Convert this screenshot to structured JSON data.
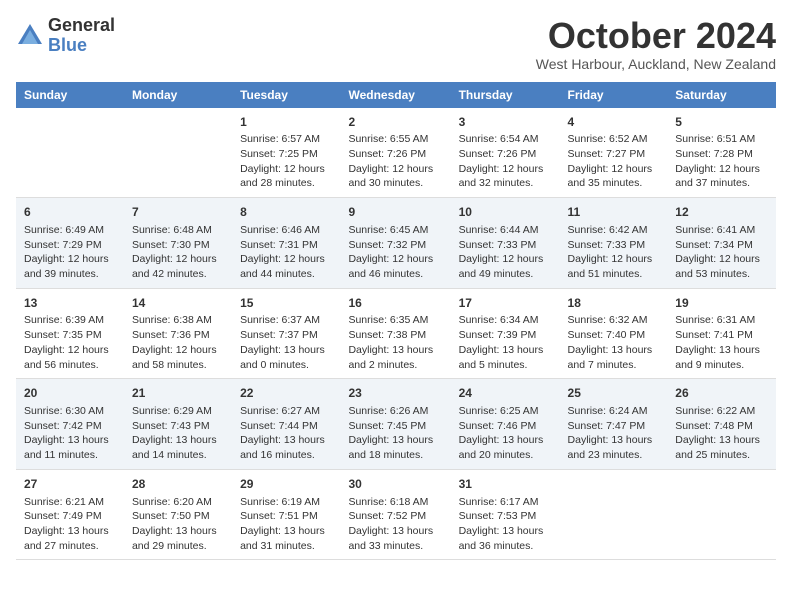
{
  "logo": {
    "text_general": "General",
    "text_blue": "Blue"
  },
  "title": "October 2024",
  "location": "West Harbour, Auckland, New Zealand",
  "days_of_week": [
    "Sunday",
    "Monday",
    "Tuesday",
    "Wednesday",
    "Thursday",
    "Friday",
    "Saturday"
  ],
  "weeks": [
    [
      {
        "day": "",
        "sunrise": "",
        "sunset": "",
        "daylight": ""
      },
      {
        "day": "",
        "sunrise": "",
        "sunset": "",
        "daylight": ""
      },
      {
        "day": "1",
        "sunrise": "Sunrise: 6:57 AM",
        "sunset": "Sunset: 7:25 PM",
        "daylight": "Daylight: 12 hours and 28 minutes."
      },
      {
        "day": "2",
        "sunrise": "Sunrise: 6:55 AM",
        "sunset": "Sunset: 7:26 PM",
        "daylight": "Daylight: 12 hours and 30 minutes."
      },
      {
        "day": "3",
        "sunrise": "Sunrise: 6:54 AM",
        "sunset": "Sunset: 7:26 PM",
        "daylight": "Daylight: 12 hours and 32 minutes."
      },
      {
        "day": "4",
        "sunrise": "Sunrise: 6:52 AM",
        "sunset": "Sunset: 7:27 PM",
        "daylight": "Daylight: 12 hours and 35 minutes."
      },
      {
        "day": "5",
        "sunrise": "Sunrise: 6:51 AM",
        "sunset": "Sunset: 7:28 PM",
        "daylight": "Daylight: 12 hours and 37 minutes."
      }
    ],
    [
      {
        "day": "6",
        "sunrise": "Sunrise: 6:49 AM",
        "sunset": "Sunset: 7:29 PM",
        "daylight": "Daylight: 12 hours and 39 minutes."
      },
      {
        "day": "7",
        "sunrise": "Sunrise: 6:48 AM",
        "sunset": "Sunset: 7:30 PM",
        "daylight": "Daylight: 12 hours and 42 minutes."
      },
      {
        "day": "8",
        "sunrise": "Sunrise: 6:46 AM",
        "sunset": "Sunset: 7:31 PM",
        "daylight": "Daylight: 12 hours and 44 minutes."
      },
      {
        "day": "9",
        "sunrise": "Sunrise: 6:45 AM",
        "sunset": "Sunset: 7:32 PM",
        "daylight": "Daylight: 12 hours and 46 minutes."
      },
      {
        "day": "10",
        "sunrise": "Sunrise: 6:44 AM",
        "sunset": "Sunset: 7:33 PM",
        "daylight": "Daylight: 12 hours and 49 minutes."
      },
      {
        "day": "11",
        "sunrise": "Sunrise: 6:42 AM",
        "sunset": "Sunset: 7:33 PM",
        "daylight": "Daylight: 12 hours and 51 minutes."
      },
      {
        "day": "12",
        "sunrise": "Sunrise: 6:41 AM",
        "sunset": "Sunset: 7:34 PM",
        "daylight": "Daylight: 12 hours and 53 minutes."
      }
    ],
    [
      {
        "day": "13",
        "sunrise": "Sunrise: 6:39 AM",
        "sunset": "Sunset: 7:35 PM",
        "daylight": "Daylight: 12 hours and 56 minutes."
      },
      {
        "day": "14",
        "sunrise": "Sunrise: 6:38 AM",
        "sunset": "Sunset: 7:36 PM",
        "daylight": "Daylight: 12 hours and 58 minutes."
      },
      {
        "day": "15",
        "sunrise": "Sunrise: 6:37 AM",
        "sunset": "Sunset: 7:37 PM",
        "daylight": "Daylight: 13 hours and 0 minutes."
      },
      {
        "day": "16",
        "sunrise": "Sunrise: 6:35 AM",
        "sunset": "Sunset: 7:38 PM",
        "daylight": "Daylight: 13 hours and 2 minutes."
      },
      {
        "day": "17",
        "sunrise": "Sunrise: 6:34 AM",
        "sunset": "Sunset: 7:39 PM",
        "daylight": "Daylight: 13 hours and 5 minutes."
      },
      {
        "day": "18",
        "sunrise": "Sunrise: 6:32 AM",
        "sunset": "Sunset: 7:40 PM",
        "daylight": "Daylight: 13 hours and 7 minutes."
      },
      {
        "day": "19",
        "sunrise": "Sunrise: 6:31 AM",
        "sunset": "Sunset: 7:41 PM",
        "daylight": "Daylight: 13 hours and 9 minutes."
      }
    ],
    [
      {
        "day": "20",
        "sunrise": "Sunrise: 6:30 AM",
        "sunset": "Sunset: 7:42 PM",
        "daylight": "Daylight: 13 hours and 11 minutes."
      },
      {
        "day": "21",
        "sunrise": "Sunrise: 6:29 AM",
        "sunset": "Sunset: 7:43 PM",
        "daylight": "Daylight: 13 hours and 14 minutes."
      },
      {
        "day": "22",
        "sunrise": "Sunrise: 6:27 AM",
        "sunset": "Sunset: 7:44 PM",
        "daylight": "Daylight: 13 hours and 16 minutes."
      },
      {
        "day": "23",
        "sunrise": "Sunrise: 6:26 AM",
        "sunset": "Sunset: 7:45 PM",
        "daylight": "Daylight: 13 hours and 18 minutes."
      },
      {
        "day": "24",
        "sunrise": "Sunrise: 6:25 AM",
        "sunset": "Sunset: 7:46 PM",
        "daylight": "Daylight: 13 hours and 20 minutes."
      },
      {
        "day": "25",
        "sunrise": "Sunrise: 6:24 AM",
        "sunset": "Sunset: 7:47 PM",
        "daylight": "Daylight: 13 hours and 23 minutes."
      },
      {
        "day": "26",
        "sunrise": "Sunrise: 6:22 AM",
        "sunset": "Sunset: 7:48 PM",
        "daylight": "Daylight: 13 hours and 25 minutes."
      }
    ],
    [
      {
        "day": "27",
        "sunrise": "Sunrise: 6:21 AM",
        "sunset": "Sunset: 7:49 PM",
        "daylight": "Daylight: 13 hours and 27 minutes."
      },
      {
        "day": "28",
        "sunrise": "Sunrise: 6:20 AM",
        "sunset": "Sunset: 7:50 PM",
        "daylight": "Daylight: 13 hours and 29 minutes."
      },
      {
        "day": "29",
        "sunrise": "Sunrise: 6:19 AM",
        "sunset": "Sunset: 7:51 PM",
        "daylight": "Daylight: 13 hours and 31 minutes."
      },
      {
        "day": "30",
        "sunrise": "Sunrise: 6:18 AM",
        "sunset": "Sunset: 7:52 PM",
        "daylight": "Daylight: 13 hours and 33 minutes."
      },
      {
        "day": "31",
        "sunrise": "Sunrise: 6:17 AM",
        "sunset": "Sunset: 7:53 PM",
        "daylight": "Daylight: 13 hours and 36 minutes."
      },
      {
        "day": "",
        "sunrise": "",
        "sunset": "",
        "daylight": ""
      },
      {
        "day": "",
        "sunrise": "",
        "sunset": "",
        "daylight": ""
      }
    ]
  ]
}
